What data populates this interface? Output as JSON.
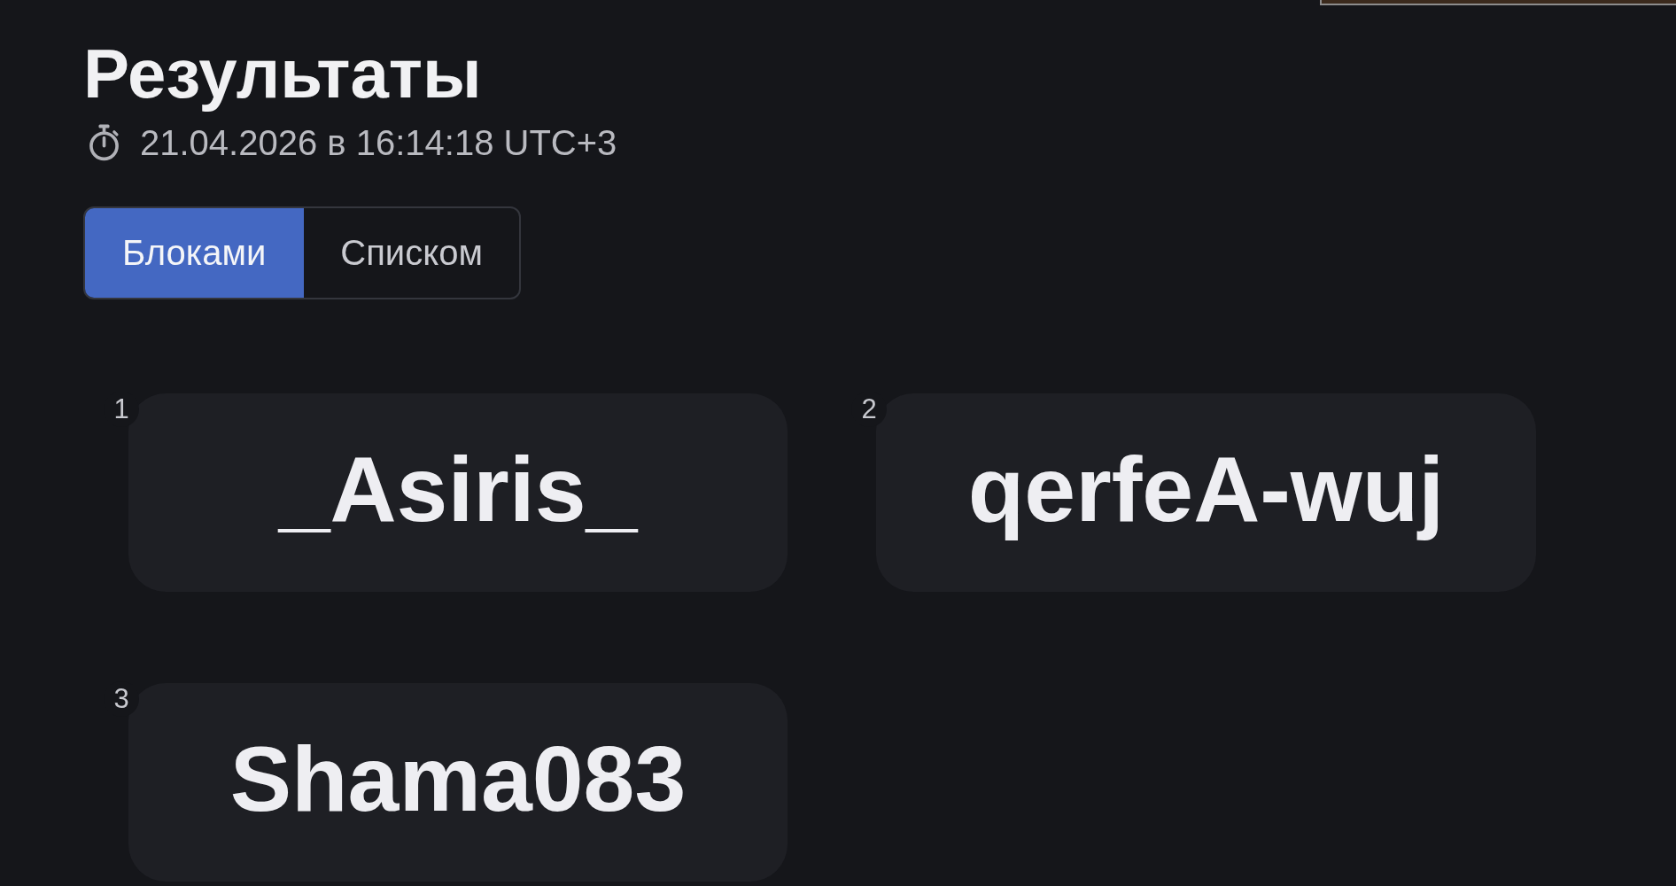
{
  "header": {
    "title": "Результаты",
    "timestamp": "21.04.2026 в 16:14:18 UTC+3"
  },
  "view_toggle": [
    {
      "label": "Блоками",
      "selected": true
    },
    {
      "label": "Списком",
      "selected": false
    }
  ],
  "results": [
    {
      "rank": "1",
      "name": "_Asiris_"
    },
    {
      "rank": "2",
      "name": "qerfeA-wuj"
    },
    {
      "rank": "3",
      "name": "Shama083"
    }
  ]
}
